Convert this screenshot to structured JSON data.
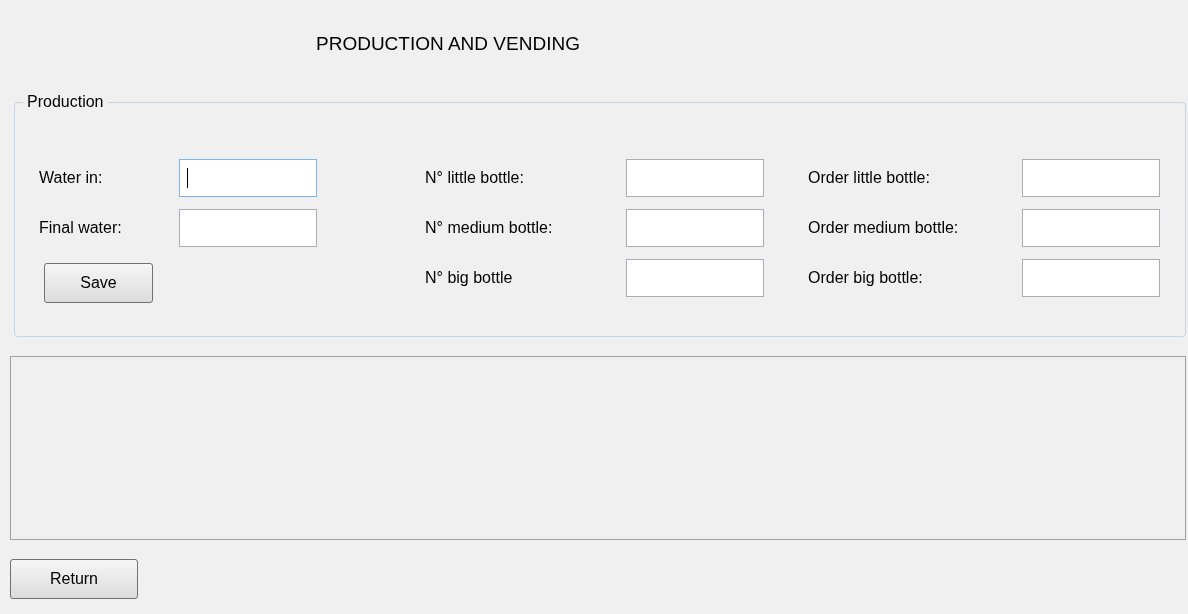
{
  "title": "PRODUCTION AND VENDING",
  "production": {
    "legend": "Production",
    "columns": [
      {
        "fields": [
          {
            "label": "Water in:",
            "focused": true
          },
          {
            "label": "Final water:",
            "focused": false
          }
        ],
        "button": "Save"
      },
      {
        "fields": [
          {
            "label": "N° little bottle:",
            "focused": false
          },
          {
            "label": "N° medium bottle:",
            "focused": false
          },
          {
            "label": "N° big bottle",
            "focused": false
          }
        ]
      },
      {
        "fields": [
          {
            "label": "Order little bottle:",
            "focused": false
          },
          {
            "label": "Order medium bottle:",
            "focused": false
          },
          {
            "label": "Order big bottle:",
            "focused": false
          }
        ]
      }
    ]
  },
  "buttons": [
    "Return"
  ]
}
